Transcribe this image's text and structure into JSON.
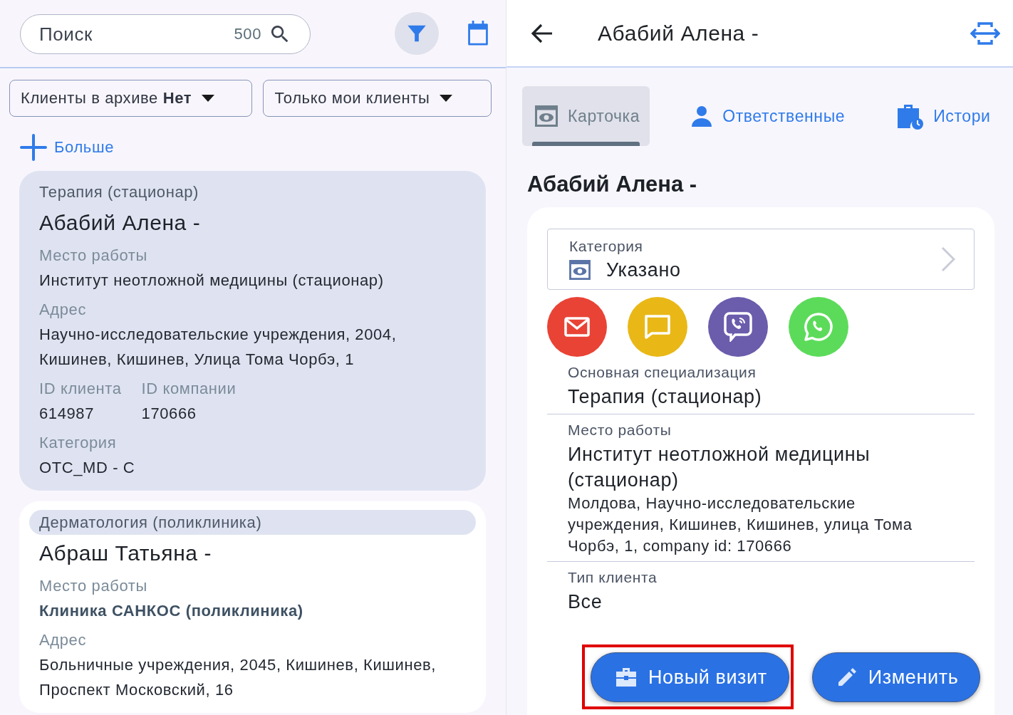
{
  "search": {
    "placeholder": "Поиск",
    "count": "500"
  },
  "filters": [
    {
      "label": "Клиенты в архиве **Нет**"
    },
    {
      "label": "Только мои клиенты"
    }
  ],
  "more_link": "Больше",
  "clients": [
    {
      "speciality": "Терапия (стационар)",
      "name": "Абабий Алена -",
      "selected": true,
      "rows": [
        [
          {
            "label": "Место работы",
            "value": "Институт неотложной медицины (стационар)",
            "bold": false
          }
        ],
        [
          {
            "label": "Адрес",
            "value": "Научно-исследовательские учреждения, 2004, Кишинев, Кишинев, Улица Тома Чорбэ, 1",
            "bold": false
          }
        ],
        [
          {
            "label": "ID клиента",
            "value": "614987",
            "bold": false
          },
          {
            "label": "ID компании",
            "value": "170666",
            "bold": false
          }
        ],
        [
          {
            "label": "Категория",
            "value": "OTC_MD - C",
            "bold": false
          }
        ]
      ]
    },
    {
      "speciality": "Дерматология (поликлиника)",
      "name": "Абраш Татьяна -",
      "selected": false,
      "rows": [
        [
          {
            "label": "Место работы",
            "value": "Клиника САНКОС (поликлиника)",
            "bold": true
          }
        ],
        [
          {
            "label": "Адрес",
            "value": "Больничные учреждения, 2045, Кишинев, Кишинев, Проспект Московский, 16",
            "bold": false
          }
        ]
      ]
    }
  ],
  "detail": {
    "title": "Абабий Алена -",
    "tabs": [
      {
        "label": "Карточка",
        "kind": "card",
        "selected": true
      },
      {
        "label": "Ответственные",
        "kind": "person",
        "selected": false
      },
      {
        "label": "Истори",
        "kind": "history",
        "selected": false
      }
    ],
    "heading": "Абабий Алена -",
    "category": {
      "label": "Категория",
      "value": "Указано"
    },
    "contacts": [
      {
        "kind": "email",
        "color": "#e94335"
      },
      {
        "kind": "sms",
        "color": "#e9b817"
      },
      {
        "kind": "viber",
        "color": "#6b5cac"
      },
      {
        "kind": "whatsapp",
        "color": "#5cdb5a"
      }
    ],
    "fields": [
      {
        "label": "Основная специализация",
        "value": "Терапия (стационар)"
      },
      {
        "label": "Место работы",
        "value": "Институт неотложной медицины (стационар)",
        "note": "Молдова, Научно-исследовательские учреждения, Кишинев, Кишинев, улица Тома Чорбэ, 1, company id: 170666"
      },
      {
        "label": "Тип клиента",
        "value": "Все"
      }
    ],
    "actions": [
      {
        "label": "Новый визит",
        "kind": "visit",
        "highlighted": true
      },
      {
        "label": "Изменить",
        "kind": "edit",
        "highlighted": false
      }
    ]
  }
}
